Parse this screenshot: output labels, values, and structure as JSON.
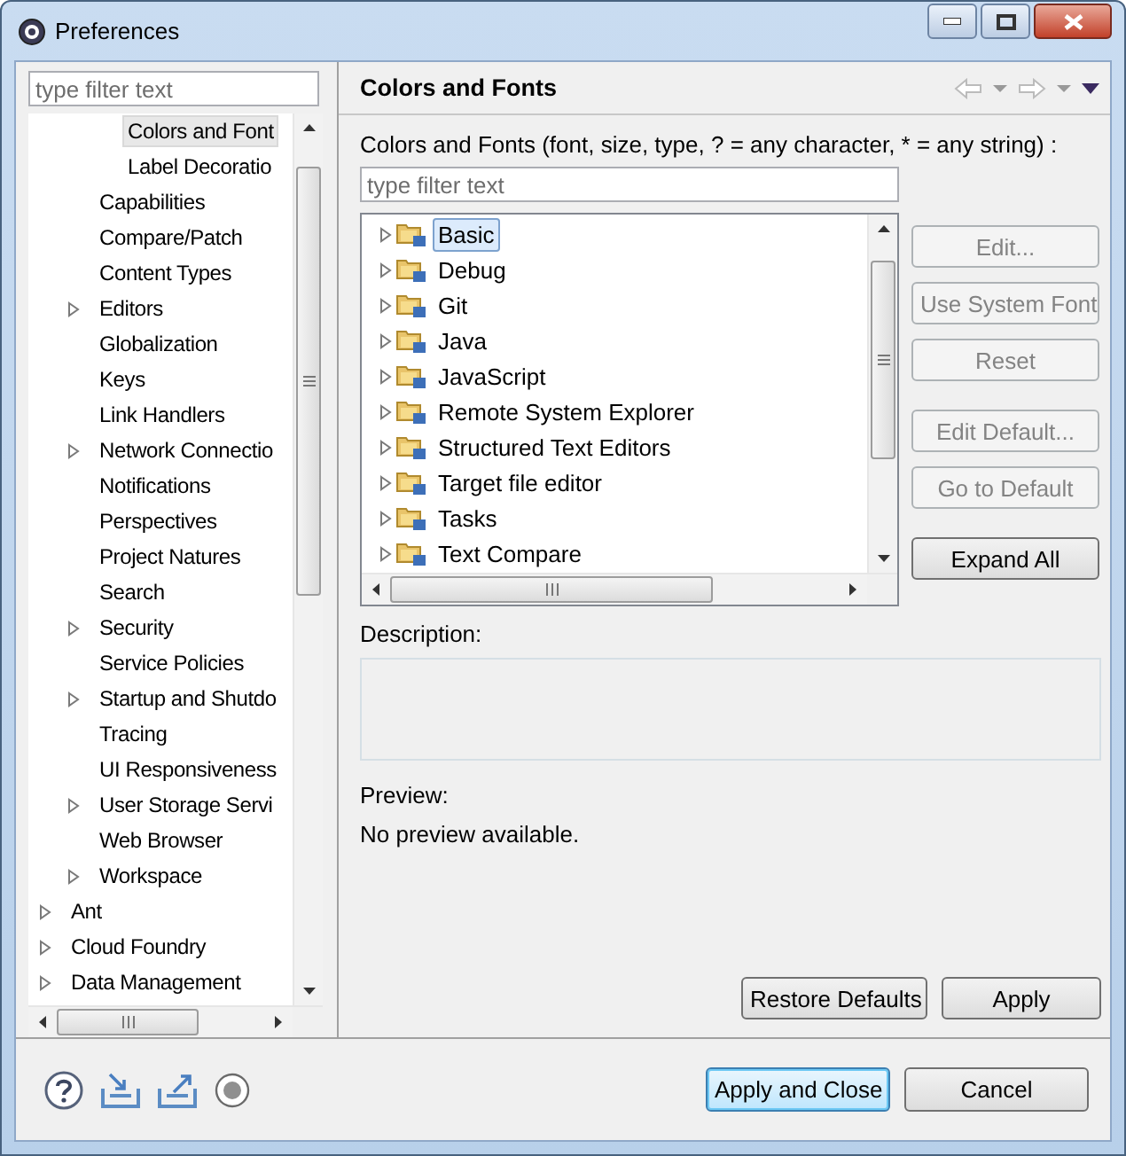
{
  "window": {
    "title": "Preferences"
  },
  "left": {
    "filter": {
      "placeholder": "type filter text"
    },
    "tree": [
      {
        "children": [
          {
            "children": [
              {
                "label": "Colors and Font",
                "expandable": false,
                "selected": true
              },
              {
                "label": "Label Decoratio",
                "expandable": false,
                "selected": false
              }
            ]
          },
          {
            "label": "Capabilities",
            "expandable": false,
            "selected": false
          },
          {
            "label": "Compare/Patch",
            "expandable": false,
            "selected": false
          },
          {
            "label": "Content Types",
            "expandable": false,
            "selected": false
          },
          {
            "label": "Editors",
            "expandable": true,
            "selected": false
          },
          {
            "label": "Globalization",
            "expandable": false,
            "selected": false
          },
          {
            "label": "Keys",
            "expandable": false,
            "selected": false
          },
          {
            "label": "Link Handlers",
            "expandable": false,
            "selected": false
          },
          {
            "label": "Network Connectio",
            "expandable": true,
            "selected": false
          },
          {
            "label": "Notifications",
            "expandable": false,
            "selected": false
          },
          {
            "label": "Perspectives",
            "expandable": false,
            "selected": false
          },
          {
            "label": "Project Natures",
            "expandable": false,
            "selected": false
          },
          {
            "label": "Search",
            "expandable": false,
            "selected": false
          },
          {
            "label": "Security",
            "expandable": true,
            "selected": false
          },
          {
            "label": "Service Policies",
            "expandable": false,
            "selected": false
          },
          {
            "label": "Startup and Shutdo",
            "expandable": true,
            "selected": false
          },
          {
            "label": "Tracing",
            "expandable": false,
            "selected": false
          },
          {
            "label": "UI Responsiveness",
            "expandable": false,
            "selected": false
          },
          {
            "label": "User Storage Servi",
            "expandable": true,
            "selected": false
          },
          {
            "label": "Web Browser",
            "expandable": false,
            "selected": false
          },
          {
            "label": "Workspace",
            "expandable": true,
            "selected": false
          }
        ]
      },
      {
        "label": "Ant",
        "expandable": true,
        "selected": false
      },
      {
        "label": "Cloud Foundry",
        "expandable": true,
        "selected": false
      },
      {
        "label": "Data Management",
        "expandable": true,
        "selected": false
      }
    ]
  },
  "page": {
    "title": "Colors and Fonts",
    "filter_label": "Colors and Fonts (font, size, type, ? = any character, * = any string) :",
    "filter": {
      "placeholder": "type filter text"
    },
    "categories": [
      {
        "label": "Basic",
        "selected": true,
        "expanded": false
      },
      {
        "label": "Debug",
        "selected": false,
        "expanded": false
      },
      {
        "label": "Git",
        "selected": false,
        "expanded": false
      },
      {
        "label": "Java",
        "selected": false,
        "expanded": false
      },
      {
        "label": "JavaScript",
        "selected": false,
        "expanded": false
      },
      {
        "label": "Remote System Explorer",
        "selected": false,
        "expanded": false
      },
      {
        "label": "Structured Text Editors",
        "selected": false,
        "expanded": false
      },
      {
        "label": "Target file editor",
        "selected": false,
        "expanded": false
      },
      {
        "label": "Tasks",
        "selected": false,
        "expanded": false
      },
      {
        "label": "Text Compare",
        "selected": false,
        "expanded": false
      }
    ],
    "side_buttons": [
      [
        {
          "label": "Edit...",
          "disabled": true
        },
        {
          "label": "Use System Font",
          "disabled": true
        },
        {
          "label": "Reset",
          "disabled": true
        }
      ],
      [
        {
          "label": "Edit Default...",
          "disabled": true
        },
        {
          "label": "Go to Default",
          "disabled": true
        }
      ],
      [
        {
          "label": "Expand All",
          "disabled": false
        }
      ]
    ],
    "description": {
      "label": "Description:"
    },
    "preview": {
      "label": "Preview:",
      "text": "No preview available."
    },
    "buttons": [
      "Restore Defaults",
      "Apply"
    ]
  },
  "footer": {
    "buttons": [
      {
        "label": "Apply and Close",
        "default": true
      },
      {
        "label": "Cancel",
        "default": false
      }
    ]
  }
}
